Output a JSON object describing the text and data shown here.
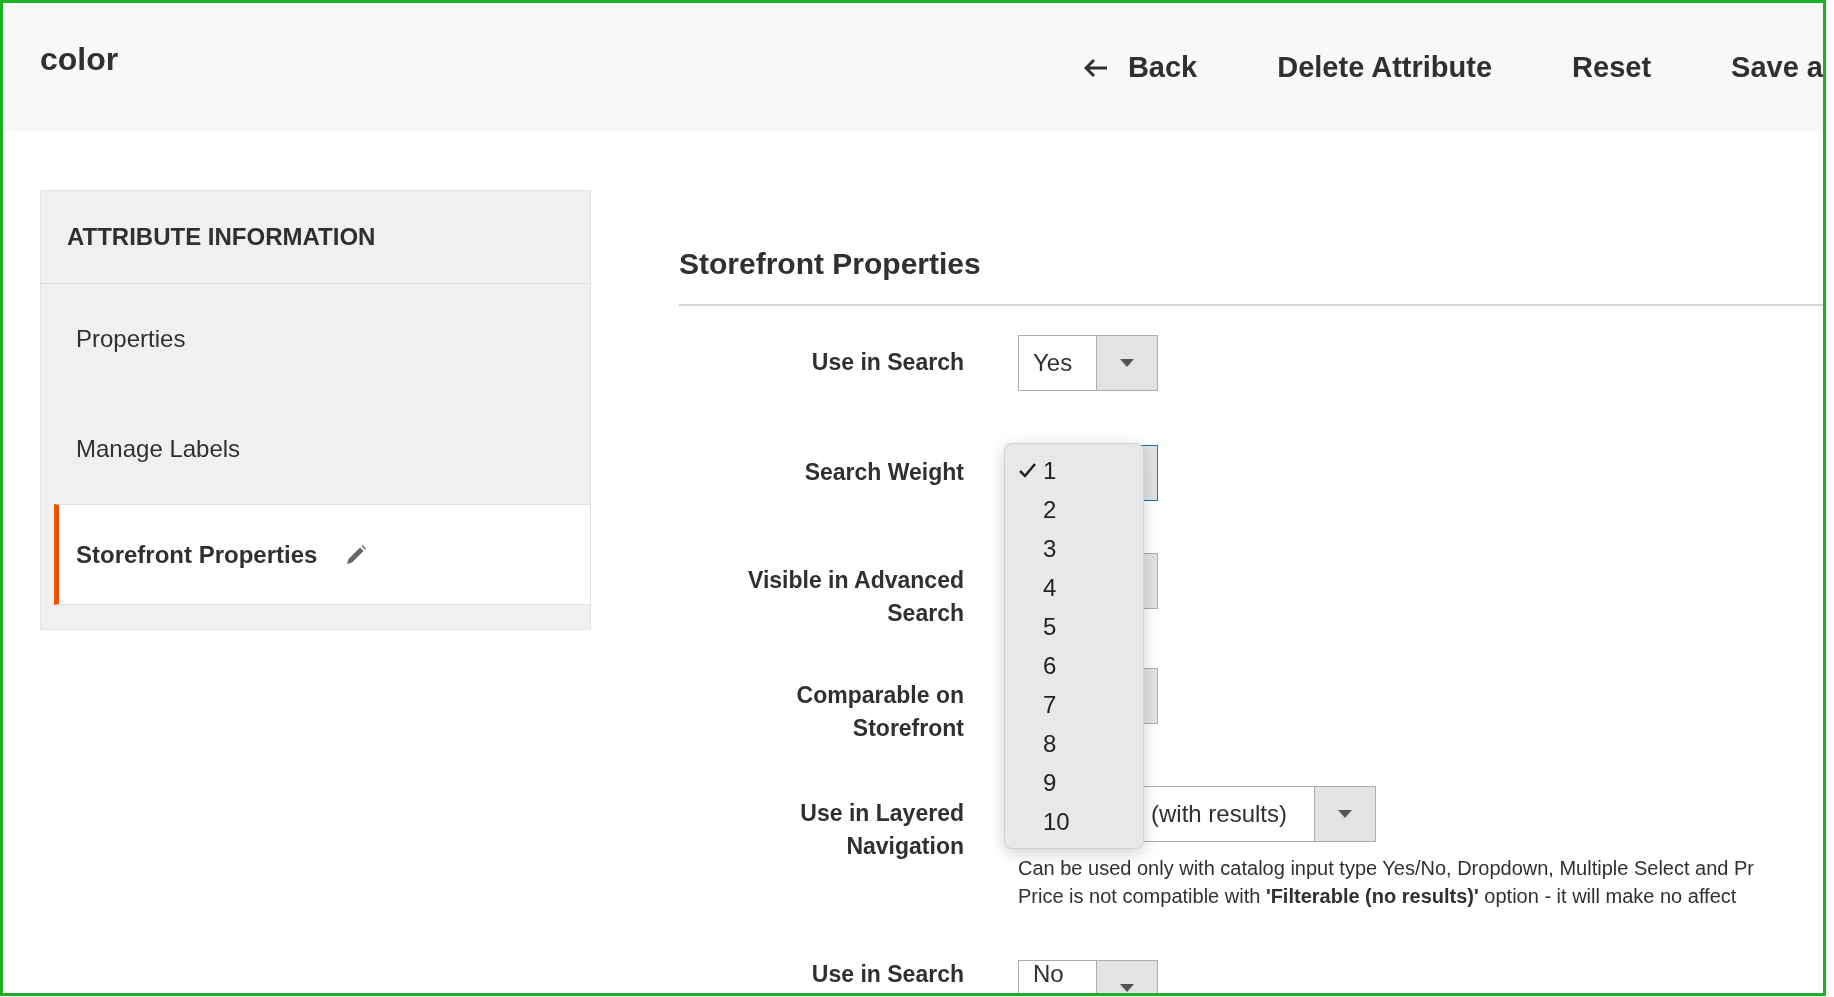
{
  "page_title": "color",
  "header_actions": [
    {
      "label": "Back",
      "kind": "back"
    },
    {
      "label": "Delete Attribute",
      "kind": "plain"
    },
    {
      "label": "Reset",
      "kind": "plain"
    },
    {
      "label": "Save a",
      "kind": "plain"
    }
  ],
  "sidebar": {
    "title": "ATTRIBUTE INFORMATION",
    "items": [
      {
        "label": "Properties",
        "selected": false,
        "edited": false
      },
      {
        "label": "Manage Labels",
        "selected": false,
        "edited": false
      },
      {
        "label": "Storefront Properties",
        "selected": true,
        "edited": true
      }
    ]
  },
  "section_title": "Storefront Properties",
  "fields": [
    {
      "label": "Use in Search",
      "kind": "select",
      "value": "Yes",
      "focused": false
    },
    {
      "label": "Search Weight",
      "kind": "select",
      "focused": true,
      "open_menu": {
        "options": [
          {
            "label": "1",
            "selected": true
          },
          {
            "label": "2",
            "selected": false
          },
          {
            "label": "3",
            "selected": false
          },
          {
            "label": "4",
            "selected": false
          },
          {
            "label": "5",
            "selected": false
          },
          {
            "label": "6",
            "selected": false
          },
          {
            "label": "7",
            "selected": false
          },
          {
            "label": "8",
            "selected": false
          },
          {
            "label": "9",
            "selected": false
          },
          {
            "label": "10",
            "selected": false
          }
        ]
      }
    },
    {
      "label": "Visible in Advanced Search",
      "kind": "select",
      "focused": false
    },
    {
      "label": "Comparable on Storefront",
      "kind": "select",
      "focused": false
    },
    {
      "label": "Use in Layered Navigation",
      "kind": "wide-select",
      "value": "(with results)",
      "focused": false,
      "note": [
        "Can be used only with catalog input type Yes/No, Dropdown, Multiple Select and Pr",
        "Price is not compatible with **'Filterable (no results)'** option - it will make no affect"
      ]
    },
    {
      "label": "Use in Search",
      "kind": "select",
      "value": "No",
      "focused": false
    }
  ]
}
